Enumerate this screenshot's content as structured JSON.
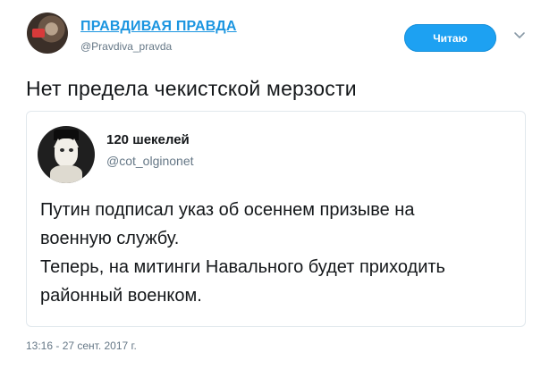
{
  "author": {
    "name": "ПРАВДИВАЯ ПРАВДА",
    "handle": "@Pravdiva_pravda"
  },
  "follow_button": {
    "label": "Читаю"
  },
  "tweet": {
    "text": "Нет предела чекистской мерзости",
    "timestamp": "13:16 - 27 сент. 2017 г."
  },
  "quoted_tweet": {
    "name": "120 шекелей",
    "handle": "@cot_olginonet",
    "lines": [
      "Путин подписал указ об осеннем призыве на",
      "военную службу.",
      "Теперь, на митинги Навального будет приходить",
      "районный военком."
    ]
  },
  "icons": {
    "menu": "chevron-down-icon"
  },
  "colors": {
    "accent": "#1da1f2",
    "link": "#1b95e0",
    "secondary_text": "#657786",
    "border": "#e1e8ed"
  }
}
